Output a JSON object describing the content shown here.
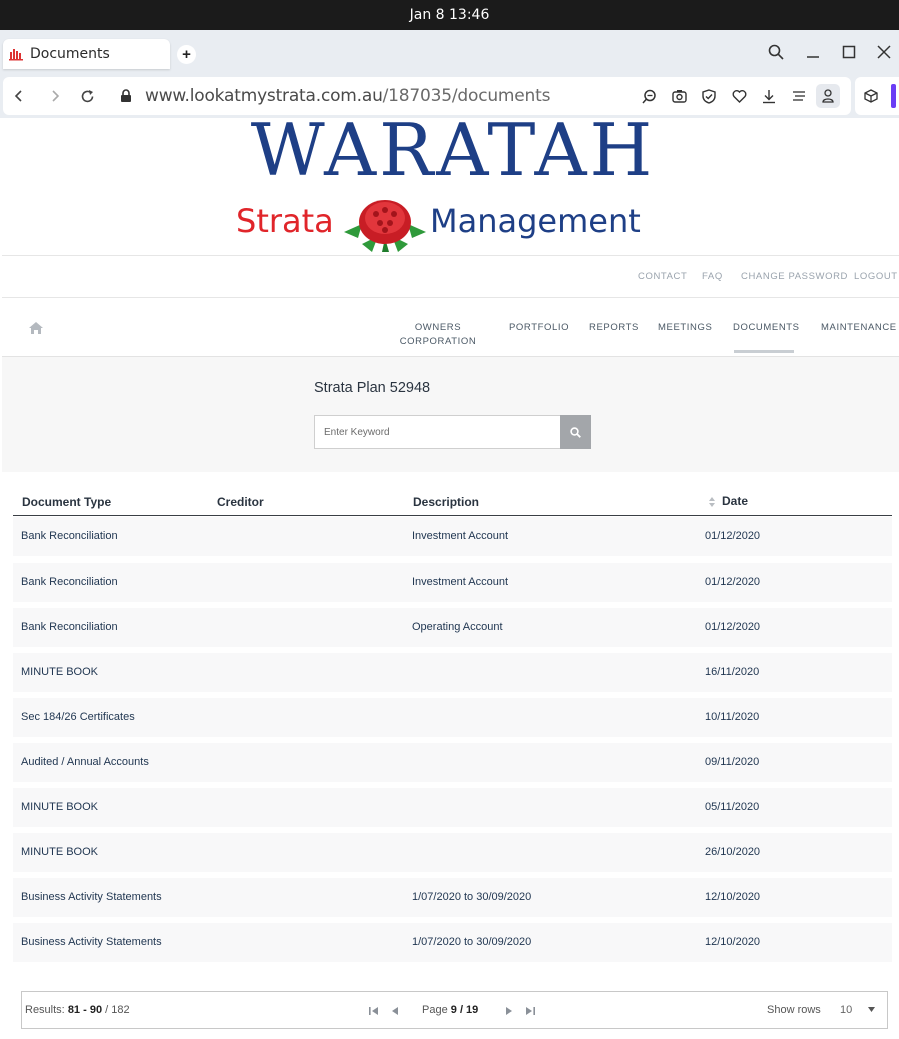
{
  "os": {
    "clock": "Jan 8  13:46"
  },
  "browser": {
    "tab_title": "Documents",
    "url_host": "www.lookatmystrata.com.au",
    "url_path": "/187035/documents"
  },
  "logo": {
    "title": "WARATAH",
    "left_word": "Strata",
    "right_word": "Management"
  },
  "top_links": [
    "CONTACT",
    "FAQ",
    "CHANGE PASSWORD",
    "LOGOUT"
  ],
  "nav": {
    "items": [
      {
        "label_line1": "OWNERS",
        "label_line2": "CORPORATION"
      },
      {
        "label_line1": "PORTFOLIO",
        "label_line2": ""
      },
      {
        "label_line1": "REPORTS",
        "label_line2": ""
      },
      {
        "label_line1": "MEETINGS",
        "label_line2": ""
      },
      {
        "label_line1": "DOCUMENTS",
        "label_line2": ""
      },
      {
        "label_line1": "MAINTENANCE",
        "label_line2": ""
      }
    ],
    "active": "DOCUMENTS"
  },
  "search": {
    "plan_title": "Strata Plan 52948",
    "placeholder": "Enter Keyword"
  },
  "table": {
    "headers": {
      "type": "Document Type",
      "creditor": "Creditor",
      "description": "Description",
      "date": "Date"
    },
    "rows": [
      {
        "type": "Bank Reconciliation",
        "creditor": "",
        "description": "Investment Account",
        "date": "01/12/2020"
      },
      {
        "type": "Bank Reconciliation",
        "creditor": "",
        "description": "Investment Account",
        "date": "01/12/2020"
      },
      {
        "type": "Bank Reconciliation",
        "creditor": "",
        "description": "Operating Account",
        "date": "01/12/2020"
      },
      {
        "type": "MINUTE BOOK",
        "creditor": "",
        "description": "",
        "date": "16/11/2020"
      },
      {
        "type": "Sec 184/26 Certificates",
        "creditor": "",
        "description": "",
        "date": "10/11/2020"
      },
      {
        "type": "Audited / Annual Accounts",
        "creditor": "",
        "description": "",
        "date": "09/11/2020"
      },
      {
        "type": "MINUTE BOOK",
        "creditor": "",
        "description": "",
        "date": "05/11/2020"
      },
      {
        "type": "MINUTE BOOK",
        "creditor": "",
        "description": "",
        "date": "26/10/2020"
      },
      {
        "type": "Business Activity Statements",
        "creditor": "",
        "description": "1/07/2020 to 30/09/2020",
        "date": "12/10/2020"
      },
      {
        "type": "Business Activity Statements",
        "creditor": "",
        "description": "1/07/2020 to 30/09/2020",
        "date": "12/10/2020"
      }
    ]
  },
  "pagination": {
    "results_label": "Results:",
    "range": "81 - 90",
    "total": "/ 182",
    "page_label": "Page",
    "page": "9 / 19",
    "show_rows_label": "Show rows",
    "rows_value": "10"
  },
  "colors": {
    "brand_blue": "#1e3f86",
    "brand_red": "#e0252a",
    "browser_accent": "#6b3df5"
  }
}
